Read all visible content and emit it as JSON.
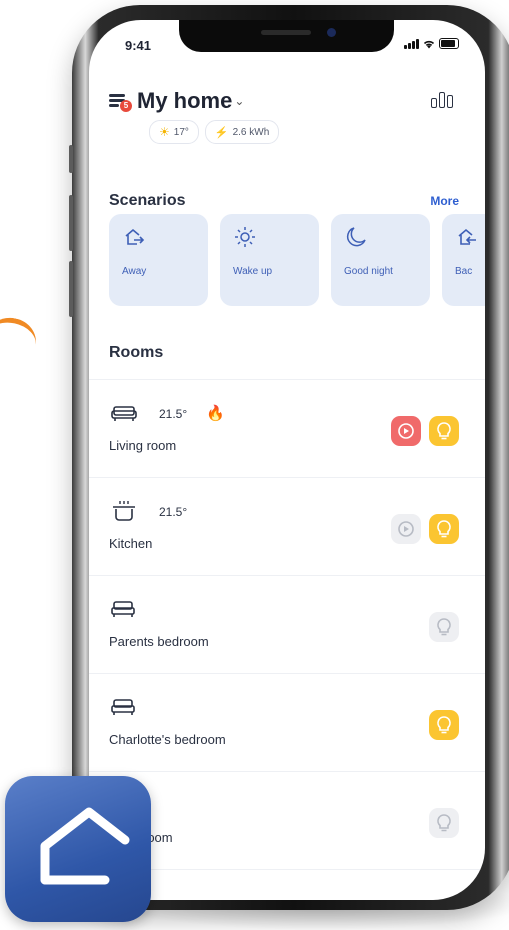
{
  "status_bar": {
    "time": "9:41",
    "signal_icon": "signal-icon",
    "wifi_icon": "wifi-icon",
    "battery_icon": "battery-icon"
  },
  "header": {
    "title": "My home",
    "menu_badge": "5",
    "weather": {
      "icon": "sun-icon",
      "value": "17°"
    },
    "energy": {
      "icon": "bolt-icon",
      "value": "2.6 kWh"
    },
    "stats_icon": "bar-chart-icon"
  },
  "scenarios": {
    "title": "Scenarios",
    "more_label": "More",
    "items": [
      {
        "label": "Away",
        "icon": "house-exit-icon"
      },
      {
        "label": "Wake up",
        "icon": "sun-outline-icon"
      },
      {
        "label": "Good night",
        "icon": "moon-icon"
      },
      {
        "label": "Bac",
        "icon": "house-back-icon"
      }
    ]
  },
  "rooms": {
    "title": "Rooms",
    "items": [
      {
        "name": "Living room",
        "temperature": "21.5°",
        "icon": "sofa-icon",
        "heating": true,
        "plug": "on",
        "light": "on"
      },
      {
        "name": "Kitchen",
        "temperature": "21.5°",
        "icon": "pot-icon",
        "heating": false,
        "plug": "off",
        "light": "on"
      },
      {
        "name": "Parents bedroom",
        "temperature": "",
        "icon": "bed-icon",
        "heating": false,
        "plug": "none",
        "light": "off"
      },
      {
        "name": "Charlotte's bedroom",
        "temperature": "",
        "icon": "bed-icon",
        "heating": false,
        "plug": "none",
        "light": "on"
      },
      {
        "name": "room",
        "temperature": "",
        "icon": "bed-icon",
        "heating": false,
        "plug": "none",
        "light": "off"
      }
    ]
  },
  "colors": {
    "accent_blue": "#2f5fd0",
    "scenario_bg": "#e4ebf7",
    "plug_on": "#f06a6a",
    "light_on": "#fbc531",
    "inactive": "#eeeff2",
    "badge": "#e84a3c",
    "app_icon": "#2f57a8",
    "decor_orange": "#f08a24"
  }
}
